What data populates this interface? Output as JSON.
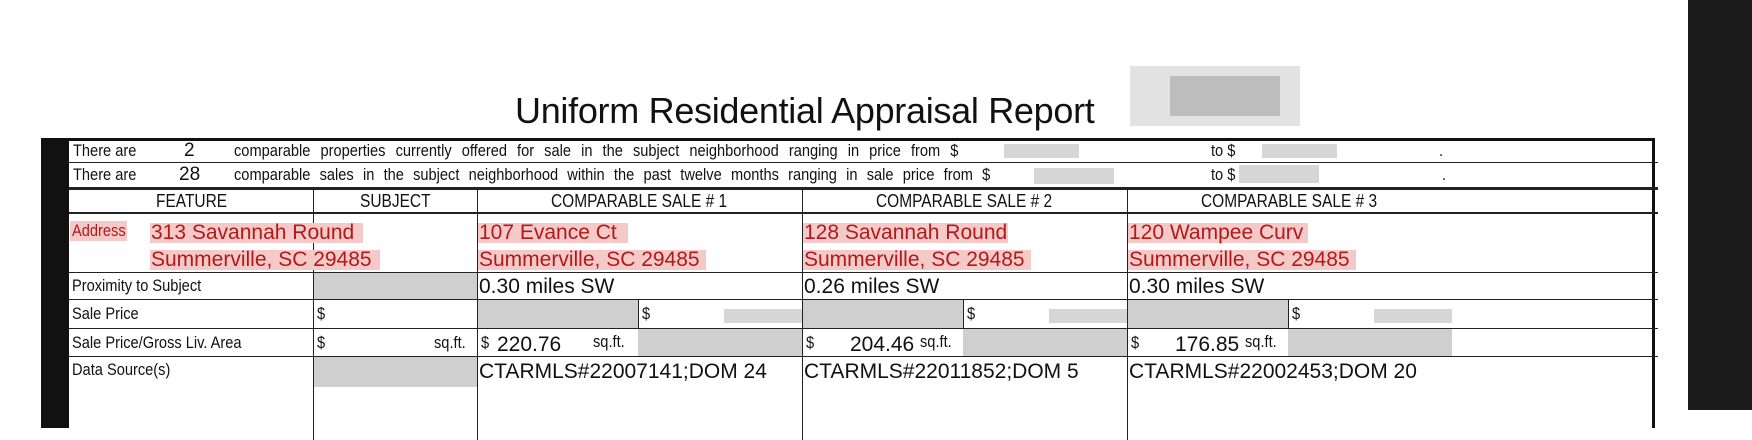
{
  "title": "Uniform Residential Appraisal Report",
  "offering_line": {
    "prefix": "There are",
    "count": "2",
    "text": "comparable properties currently offered for sale in the subject neighborhood ranging in price from $",
    "to": "to $",
    "end": "."
  },
  "sales_line": {
    "prefix": "There are",
    "count": "28",
    "text": "comparable sales in the subject neighborhood within the past twelve months ranging in sale price from $",
    "to": "to $",
    "end": "."
  },
  "headers": {
    "feature": "FEATURE",
    "subject": "SUBJECT",
    "comp1": "COMPARABLE SALE # 1",
    "comp2": "COMPARABLE SALE # 2",
    "comp3": "COMPARABLE SALE # 3"
  },
  "row_labels": {
    "address": "Address",
    "proximity": "Proximity to Subject",
    "sale_price": "Sale Price",
    "price_per_area": "Sale Price/Gross Liv. Area",
    "data_sources": "Data Source(s)"
  },
  "subject": {
    "address_line1": "313 Savannah Round",
    "address_line2": "Summerville, SC 29485",
    "sale_price_symbol": "$",
    "ppa_symbol": "$",
    "ppa_unit": "sq.ft."
  },
  "comps": [
    {
      "address_line1": "107 Evance Ct",
      "address_line2": "Summerville, SC 29485",
      "proximity": "0.30 miles SW",
      "sale_price_symbol": "$",
      "ppa_symbol": "$",
      "ppa_value": "220.76",
      "ppa_unit": "sq.ft.",
      "data_source": "CTARMLS#22007141;DOM 24"
    },
    {
      "address_line1": "128 Savannah Round",
      "address_line2": "Summerville, SC 29485",
      "proximity": "0.26 miles SW",
      "sale_price_symbol": "$",
      "ppa_symbol": "$",
      "ppa_value": "204.46",
      "ppa_unit": "sq.ft.",
      "data_source": "CTARMLS#22011852;DOM 5"
    },
    {
      "address_line1": "120 Wampee Curv",
      "address_line2": "Summerville, SC 29485",
      "proximity": "0.30 miles SW",
      "sale_price_symbol": "$",
      "ppa_symbol": "$",
      "ppa_value": "176.85",
      "ppa_unit": "sq.ft.",
      "data_source": "CTARMLS#22002453;DOM 20"
    }
  ]
}
